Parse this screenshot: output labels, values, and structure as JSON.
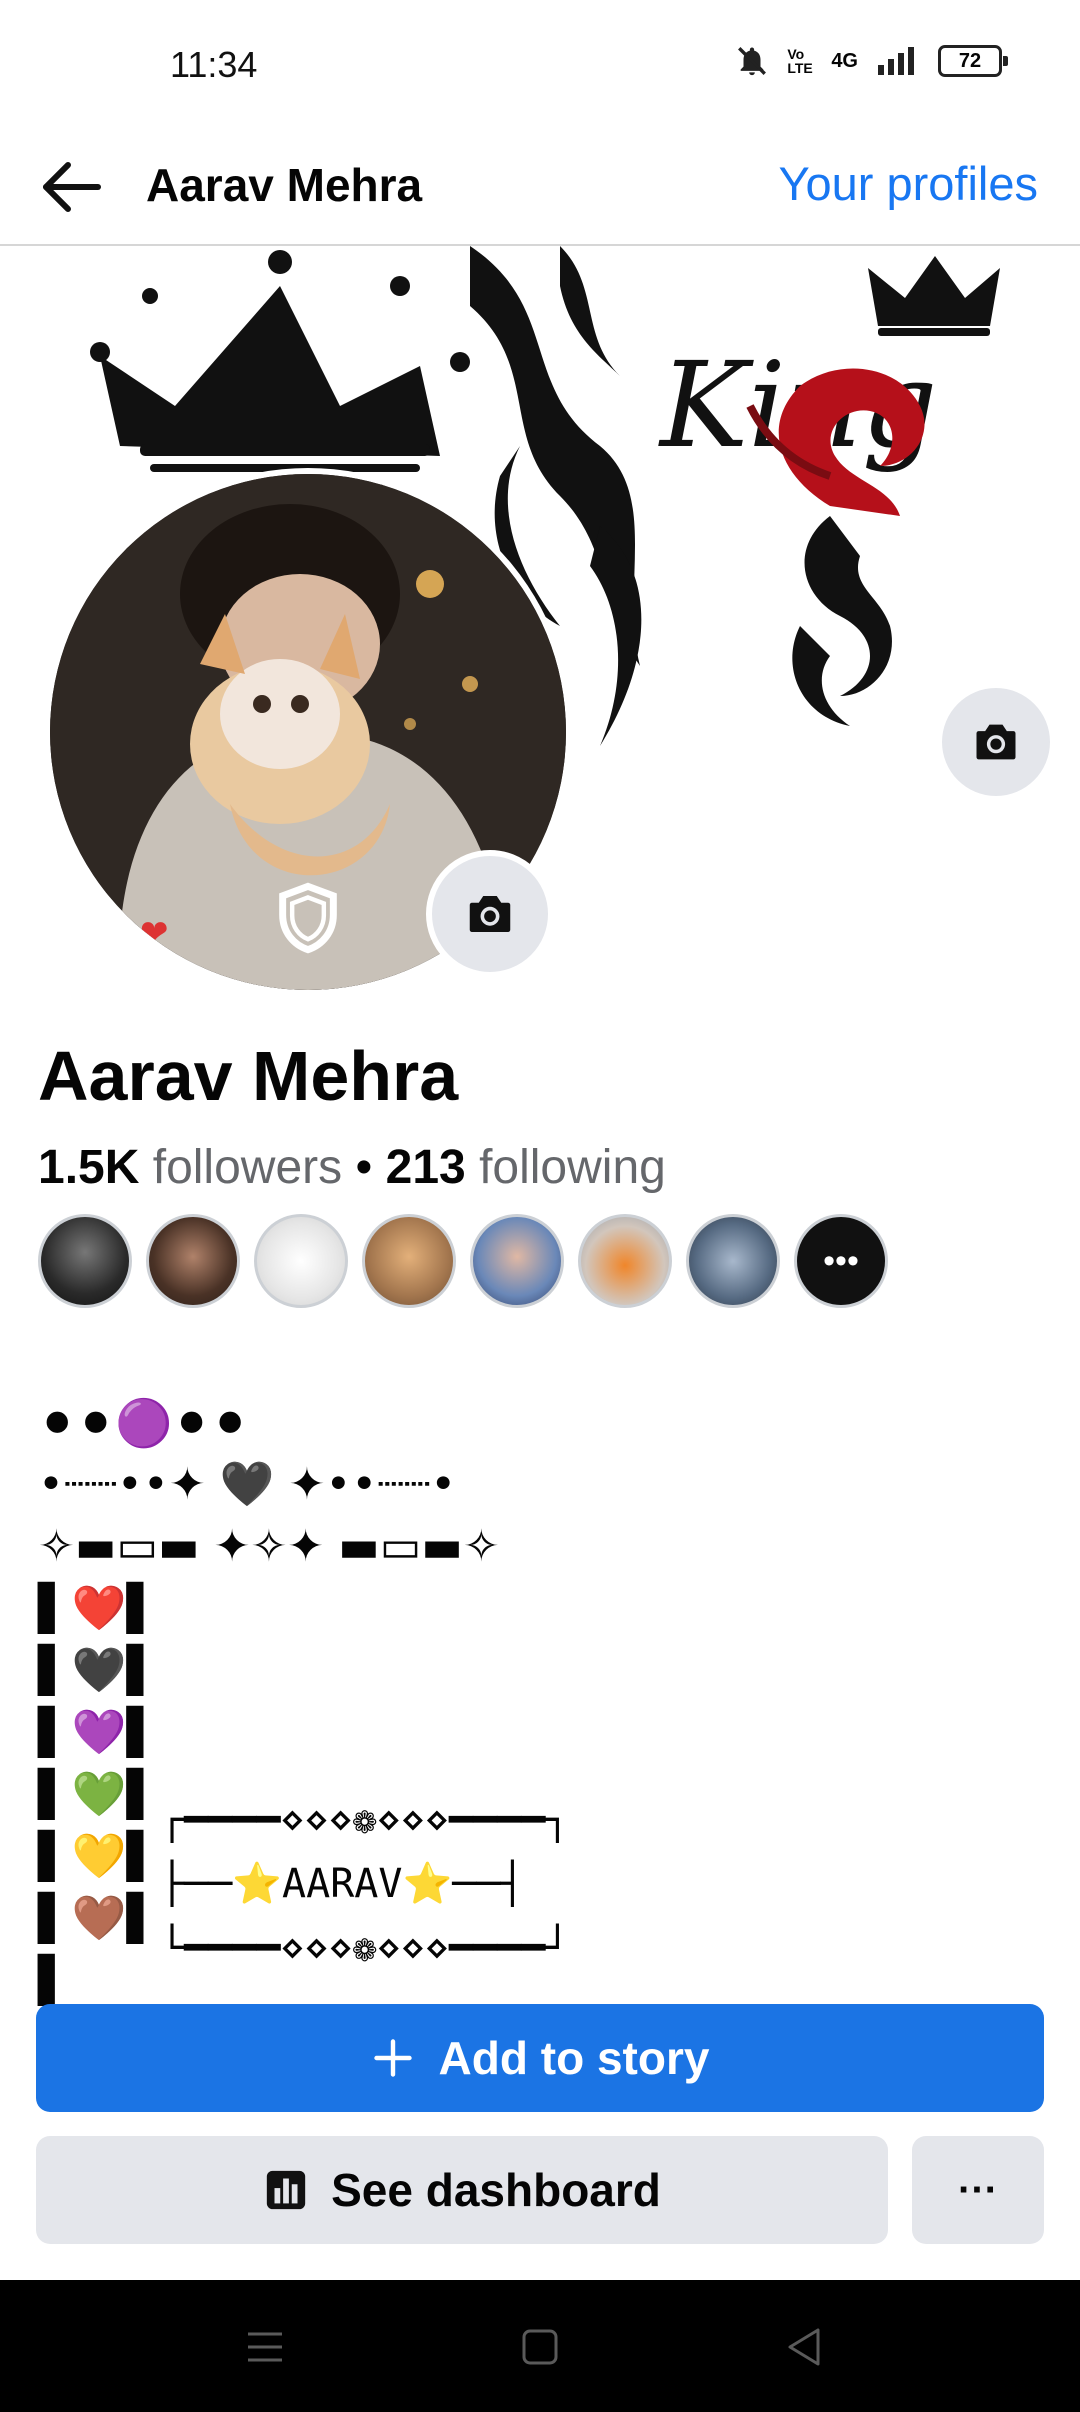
{
  "status": {
    "time": "11:34",
    "network": "4G",
    "volte": "Vo LTE",
    "battery": "72"
  },
  "header": {
    "title": "Aarav Mehra",
    "your_profiles": "Your profiles"
  },
  "cover": {
    "word": "King"
  },
  "profile": {
    "name": "Aarav Mehra",
    "followers_count": "1.5K",
    "followers_label": "followers",
    "separator": " • ",
    "following_count": "213",
    "following_label": "following"
  },
  "bio": {
    "line1": "⚫⚫🟣⚫⚫",
    "line2": "•┈┈••✦ 🖤 ✦••┈┈•",
    "line3": "✧▬▭▬ ✦✧✦ ▬▭▬✧",
    "line4": "▌❤️▌",
    "line5": "▌🖤▌",
    "line6": "▌💜▌",
    "line7": "▌💚▌",
    "line8": "▌💛▌",
    "line9": "▌🤎▌",
    "line10": "▌",
    "frame_top": "┌━━━━⋄⋄⋄❁⋄⋄⋄━━━━┐",
    "frame_mid": "├──⭐AARAV⭐──┤",
    "frame_bottom": "└━━━━⋄⋄⋄❁⋄⋄⋄━━━━┘"
  },
  "actions": {
    "add_story": "Add to story",
    "dashboard": "See dashboard",
    "more": "···"
  },
  "colors": {
    "accent": "#1877f2",
    "button_primary": "#1b74e4",
    "button_secondary": "#e4e6eb"
  }
}
